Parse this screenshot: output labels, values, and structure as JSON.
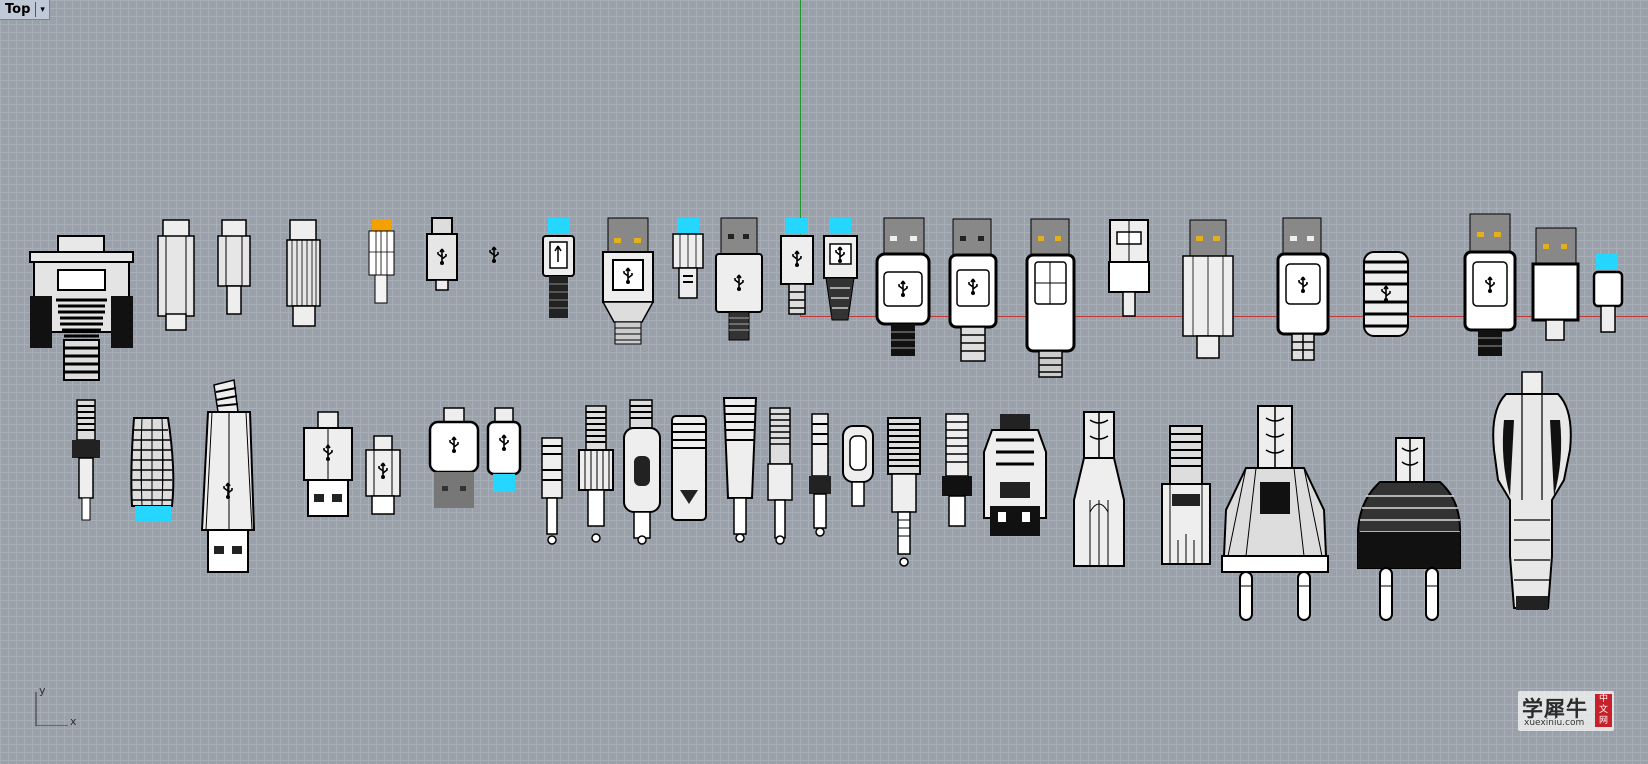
{
  "viewport": {
    "name": "Top",
    "menu_arrow": "▾",
    "background_color": "#9ba1aa",
    "grid_minor_color": "#a9afb7",
    "grid_major_color": "#93999f",
    "y_axis_color": "#1f9a2e",
    "x_axis_color": "#c03a3a"
  },
  "world_axes": {
    "y_label": "y",
    "x_label": "x"
  },
  "selection_color": "#25d6ff",
  "watermark": {
    "title": "学犀牛",
    "url": "xuexiniu.com",
    "seal": "中文网"
  },
  "models": {
    "row1_count": 27,
    "row2_count": 27,
    "description_icon": "usb-trident-icon"
  }
}
